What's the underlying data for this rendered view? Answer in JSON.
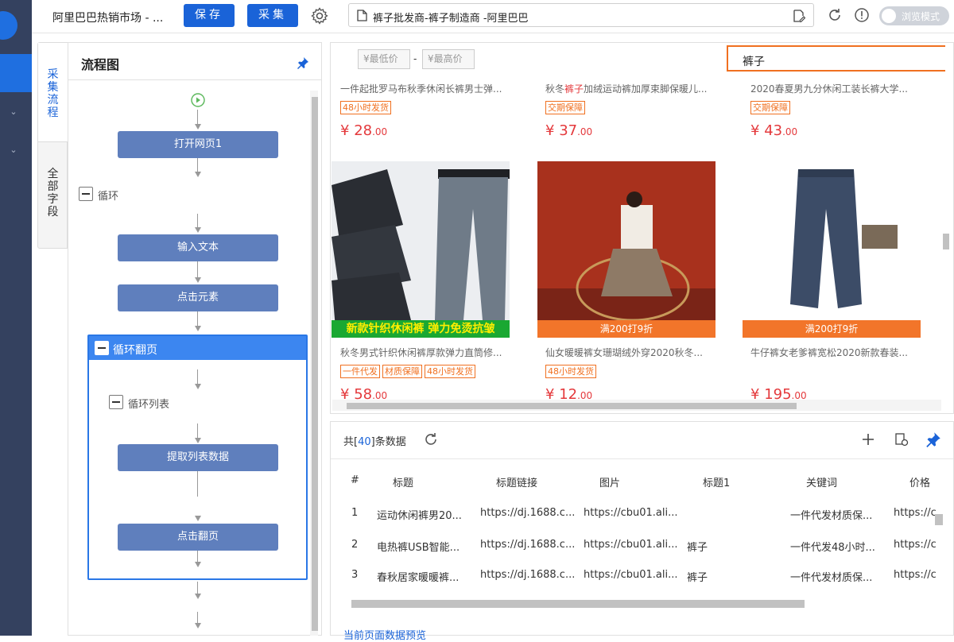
{
  "app": {
    "title": "阿里巴巴热销市场 - ...",
    "save_label": "保存",
    "collect_label": "采集",
    "browse_mode_label": "浏览模式"
  },
  "url_bar": {
    "value": "裤子批发商-裤子制造商 -阿里巴巴"
  },
  "side_tabs": [
    {
      "label": [
        "采",
        "集",
        "流",
        "程"
      ]
    },
    {
      "label": [
        "全",
        "部",
        "字",
        "段"
      ]
    }
  ],
  "flow": {
    "title": "流程图",
    "nodes": {
      "open_page": "打开网页1",
      "loop": "循环",
      "input_text": "输入文本",
      "click_element": "点击元素",
      "loop_paging": "循环翻页",
      "loop_list": "循环列表",
      "extract_list": "提取列表数据",
      "click_next": "点击翻页"
    }
  },
  "filter": {
    "min_price_placeholder": "¥最低价",
    "max_price_placeholder": "¥最高价",
    "dash": "-",
    "keyword": "裤子"
  },
  "products_top": [
    {
      "title": "一件起批罗马布秋季休闲长裤男士弹...",
      "tags": [
        "48小时发货"
      ],
      "price": "28",
      "cents": ".00"
    },
    {
      "title_pre": "秋冬",
      "title_hl": "裤子",
      "title_post": "加绒运动裤加厚束脚保暖儿...",
      "tags": [
        "交期保障"
      ],
      "price": "37",
      "cents": ".00"
    },
    {
      "title": "2020春夏男九分休闲工装长裤大学...",
      "tags": [
        "交期保障"
      ],
      "price": "43",
      "cents": ".00"
    }
  ],
  "products_bottom": [
    {
      "banner": "新款针织休闲裤 弹力免烫抗皱",
      "title": "秋冬男式针织休闲裤厚款弹力直筒修...",
      "tags": [
        "一件代发",
        "材质保障",
        "48小时发货"
      ],
      "price": "58",
      "cents": ".00"
    },
    {
      "banner": "满200打9折",
      "title": "仙女暖暖裤女珊瑚绒外穿2020秋冬...",
      "tags": [
        "48小时发货"
      ],
      "price": "12",
      "cents": ".00"
    },
    {
      "banner": "满200打9折",
      "title": "牛仔裤女老爹裤宽松2020新款春装...",
      "tags": [],
      "price": "195",
      "cents": ".00"
    }
  ],
  "data_table": {
    "count_prefix": "共[",
    "count": "40",
    "count_suffix": "]条数据",
    "columns": [
      "#",
      "标题",
      "标题链接",
      "图片",
      "标题1",
      "关键词",
      "价格"
    ],
    "rows": [
      [
        "1",
        "运动休闲裤男20...",
        "https://dj.1688.c...",
        "https://cbu01.ali...",
        "",
        "一件代发材质保...",
        "https://c"
      ],
      [
        "2",
        "电热裤USB智能...",
        "https://dj.1688.c...",
        "https://cbu01.ali...",
        "裤子",
        "一件代发48小时...",
        "https://c"
      ],
      [
        "3",
        "春秋居家暖暖裤...",
        "https://dj.1688.c...",
        "https://cbu01.ali...",
        "裤子",
        "一件代发材质保...",
        "https://c"
      ]
    ],
    "preview_tab": "当前页面数据预览"
  },
  "colors": {
    "brand": "#1a63d8",
    "accent": "#f07020",
    "price": "#e4393c",
    "node": "#5f7fbd"
  },
  "icons": [
    "gear-icon",
    "document-icon",
    "edit-icon",
    "refresh-icon",
    "info-icon",
    "pin-icon",
    "play-icon",
    "plus-icon",
    "settings-doc-icon"
  ]
}
